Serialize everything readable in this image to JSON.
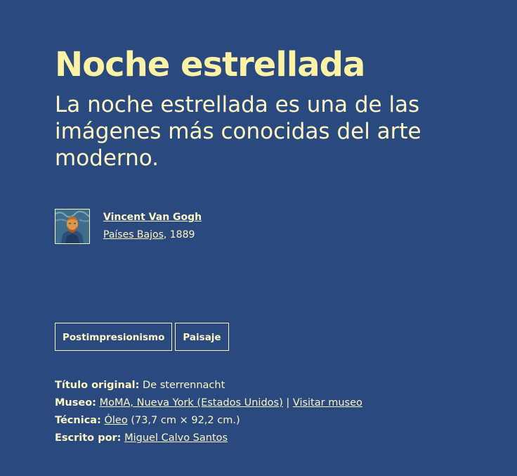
{
  "artwork": {
    "title": "Noche estrellada",
    "subtitle": "La noche estrellada es una de las imágenes más conocidas del arte moderno."
  },
  "author": {
    "name": "Vincent Van Gogh",
    "country": "Países Bajos",
    "year_text": ", 1889"
  },
  "tags": [
    "Postimpresionismo",
    "Paisaje"
  ],
  "details": {
    "original_title_label": "Título original:",
    "original_title_value": "De sterrennacht",
    "museum_label": "Museo:",
    "museum_link": "MoMA, Nueva York (Estados Unidos)",
    "museum_separator": " | ",
    "visit_museum_link": "Visitar museo",
    "technique_label": "Técnica:",
    "technique_link": "Óleo",
    "technique_dims": "(73,7 cm × 92,2 cm.)",
    "written_by_label": "Escrito por:",
    "written_by_link": "Miguel Calvo Santos"
  },
  "colors": {
    "background": "#2a4a7f",
    "text": "#fdf6c4",
    "title": "#fbf2a6"
  }
}
